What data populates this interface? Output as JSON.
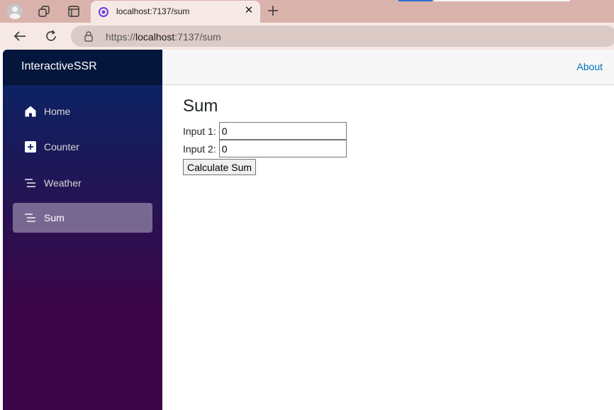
{
  "browser": {
    "tab_title": "localhost:7137/sum",
    "url_prefix": "https://",
    "url_host": "localhost",
    "url_rest": ":7137/sum",
    "icons": [
      "profile-icon",
      "workspaces-icon",
      "tab-actions-icon",
      "favicon-icon",
      "close-icon",
      "plus-icon",
      "back-icon",
      "refresh-icon",
      "lock-icon"
    ]
  },
  "app": {
    "brand": "InteractiveSSR",
    "about_label": "About",
    "nav": [
      {
        "label": "Home",
        "icon": "home-icon",
        "active": false
      },
      {
        "label": "Counter",
        "icon": "plus-square-icon",
        "active": false
      },
      {
        "label": "Weather",
        "icon": "list-icon",
        "active": false
      },
      {
        "label": "Sum",
        "icon": "list-icon",
        "active": true
      }
    ]
  },
  "page": {
    "title": "Sum",
    "input1_label": "Input 1:",
    "input1_value": "0",
    "input2_label": "Input 2:",
    "input2_value": "0",
    "button_label": "Calculate Sum"
  },
  "colors": {
    "sidebar_top": "#052767",
    "sidebar_bottom": "#3a0647",
    "link": "#0071c1",
    "browser_frame": "#d9b3ab"
  }
}
